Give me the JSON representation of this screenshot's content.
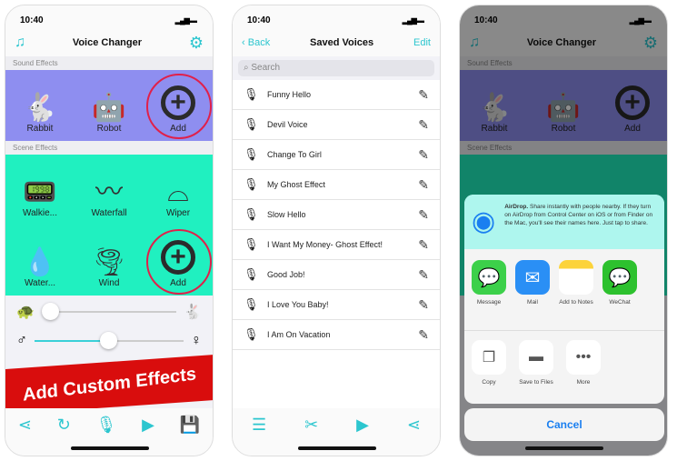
{
  "time": "10:40",
  "colors": {
    "accent": "#2cc6cf",
    "sound_band": "#8e8ef0",
    "scene_band": "#20f0c0",
    "banner": "#d90d0d",
    "ring": "#e0204a"
  },
  "screen1": {
    "title": "Voice Changer",
    "sound_label": "Sound Effects",
    "scene_label": "Scene Effects",
    "sound_effects": [
      {
        "label": "Rabbit",
        "icon": "rabbit-icon"
      },
      {
        "label": "Robot",
        "icon": "robot-icon"
      },
      {
        "label": "Add",
        "icon": "plus-circle-icon"
      }
    ],
    "scene_effects": [
      {
        "label": "Walkie...",
        "icon": "walkie-talkie-icon"
      },
      {
        "label": "Waterfall",
        "icon": "waterfall-icon"
      },
      {
        "label": "Wiper",
        "icon": "wiper-icon"
      },
      {
        "label": "Water...",
        "icon": "water-drop-icon"
      },
      {
        "label": "Wind",
        "icon": "tornado-icon"
      },
      {
        "label": "Add",
        "icon": "plus-circle-icon"
      }
    ],
    "speed_slider": 0.05,
    "pitch_slider": 0.5,
    "banner": "Add Custom Effects"
  },
  "screen2": {
    "back": "Back",
    "title": "Saved Voices",
    "edit": "Edit",
    "search_placeholder": "Search",
    "items": [
      "Funny Hello",
      "Devil Voice",
      "Change To Girl",
      "My Ghost Effect",
      "Slow Hello",
      "I Want My Money- Ghost Effect!",
      "Good Job!",
      "I Love You Baby!",
      "I Am On Vacation"
    ]
  },
  "screen3": {
    "airdrop_title": "AirDrop.",
    "airdrop_text": " Share instantly with people nearby. If they turn on AirDrop from Control Center on iOS or from Finder on the Mac, you'll see their names here. Just tap to share.",
    "apps": [
      "Message",
      "Mail",
      "Add to Notes",
      "WeChat"
    ],
    "actions": [
      "Copy",
      "Save to Files",
      "More"
    ],
    "cancel": "Cancel"
  }
}
